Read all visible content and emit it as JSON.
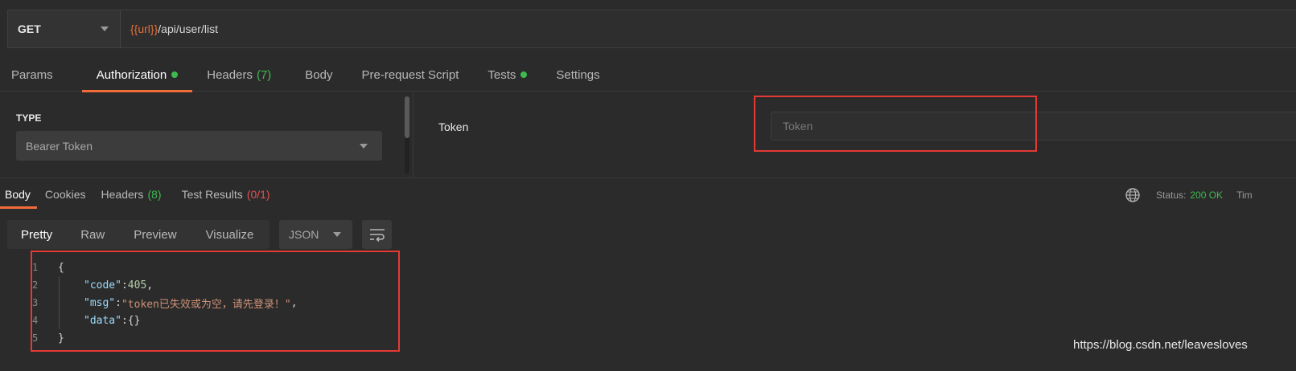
{
  "request": {
    "method": "GET",
    "url_var": "{{url}}",
    "url_path": "/api/user/list"
  },
  "request_tabs": [
    {
      "label": "Params",
      "badge": "",
      "dot": false,
      "active": false
    },
    {
      "label": "Authorization",
      "badge": "",
      "dot": true,
      "active": true
    },
    {
      "label": "Headers",
      "badge": "(7)",
      "dot": false,
      "active": false
    },
    {
      "label": "Body",
      "badge": "",
      "dot": false,
      "active": false
    },
    {
      "label": "Pre-request Script",
      "badge": "",
      "dot": false,
      "active": false
    },
    {
      "label": "Tests",
      "badge": "",
      "dot": true,
      "active": false
    },
    {
      "label": "Settings",
      "badge": "",
      "dot": false,
      "active": false
    }
  ],
  "auth": {
    "type_label": "TYPE",
    "type_value": "Bearer Token",
    "token_label": "Token",
    "token_placeholder": "Token"
  },
  "response_tabs": [
    {
      "label": "Body",
      "badge": "",
      "active": true
    },
    {
      "label": "Cookies",
      "badge": "",
      "active": false
    },
    {
      "label": "Headers",
      "badge": "(8)",
      "active": false
    },
    {
      "label": "Test Results",
      "badge": "(0/1)",
      "active": false
    }
  ],
  "status": {
    "label": "Status:",
    "value": "200 OK",
    "time_label": "Tim"
  },
  "format_tabs": [
    "Pretty",
    "Raw",
    "Preview",
    "Visualize"
  ],
  "language": "JSON",
  "code": {
    "line_numbers": [
      "1",
      "2",
      "3",
      "4",
      "5"
    ],
    "open_brace": "{",
    "close_brace": "}",
    "fields": [
      {
        "key": "\"code\"",
        "value": "405",
        "kind": "num",
        "trail": ","
      },
      {
        "key": "\"msg\"",
        "value": "\"token已失效或为空，请先登录！\"",
        "kind": "str",
        "trail": ","
      },
      {
        "key": "\"data\"",
        "value": "{}",
        "kind": "punct",
        "trail": ""
      }
    ]
  },
  "watermark": "https://blog.csdn.net/leavesloves",
  "colors": {
    "accent": "#f26b3a",
    "success": "#3fb950",
    "error": "#e05252",
    "highlight_box": "#e53935"
  }
}
